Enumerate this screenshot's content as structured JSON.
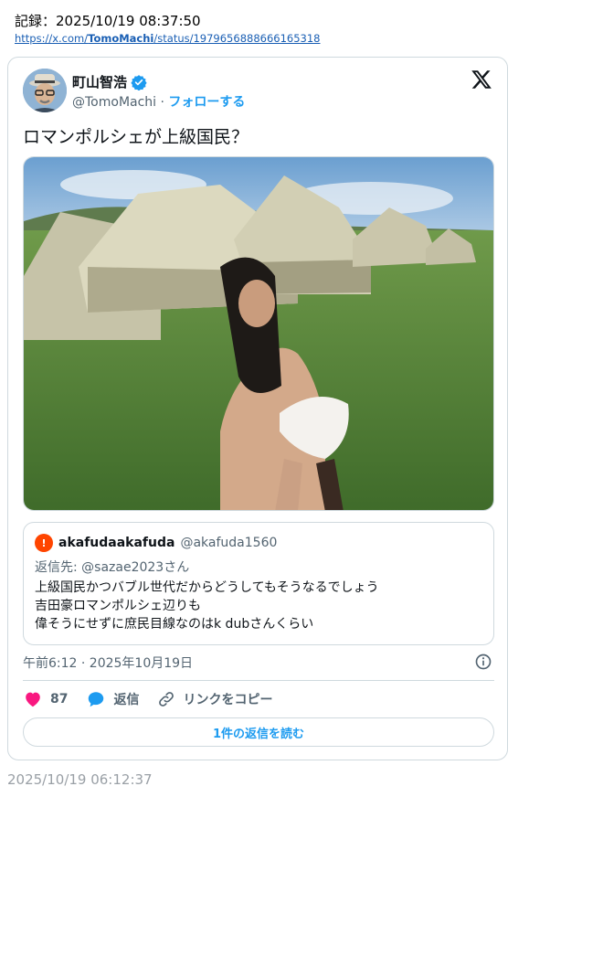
{
  "record": {
    "label": "記録：2025/10/19 08:37:50",
    "url_prefix": "https://x.com/",
    "url_user": "TomoMachi",
    "url_suffix": "/status/1979656888666165318"
  },
  "tweet": {
    "display_name": "町山智浩",
    "handle": "@TomoMachi",
    "separator": "·",
    "follow_label": "フォローする",
    "text": "ロマンポルシェが上級国民？",
    "timestamp": "午前6:12 · 2025年10月19日",
    "likes": "87",
    "reply_label": "返信",
    "copy_link_label": "リンクをコピー",
    "read_replies_label": "1件の返信を読む"
  },
  "quote": {
    "avatar_letter": "!",
    "display_name": "akafudaakafuda",
    "handle": "@akafuda1560",
    "reply_to": "返信先: @sazae2023さん",
    "lines": [
      "上級国民かつバブル世代だからどうしてもそうなるでしょう",
      "吉田豪ロマンポルシェ辺りも",
      "偉そうにせずに庶民目線なのはk dubさんくらい"
    ]
  },
  "archive_timestamp": "2025/10/19 06:12:37",
  "icons": {
    "verified": "verified-badge-icon",
    "x_logo": "x-logo-icon",
    "like": "heart-icon",
    "reply": "speech-bubble-icon",
    "copy": "link-icon",
    "info": "info-icon"
  },
  "colors": {
    "accent": "#1d9bf0",
    "like": "#f91880",
    "muted": "#536471",
    "border": "#cfd9de",
    "quote_avatar": "#ff4500"
  }
}
